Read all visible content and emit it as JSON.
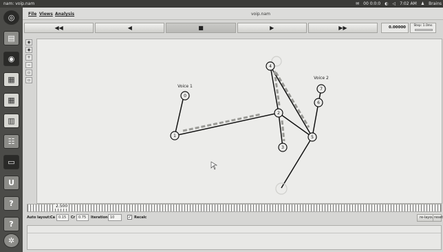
{
  "system_bar": {
    "window_title": "nam: voip.nam",
    "tray_text": "00 0:0:0",
    "time": "7:02 AM",
    "user": "Brains"
  },
  "menu": {
    "items": [
      "File",
      "Views",
      "Analysis"
    ],
    "window_title": "voip.nam"
  },
  "transport": {
    "buttons": [
      "◀◀",
      "◀",
      "■",
      "▶",
      "▶▶"
    ],
    "icons": [
      "rewind-icon",
      "play-back-icon",
      "stop-icon",
      "play-icon",
      "fast-forward-icon"
    ],
    "time_value": "0.00000",
    "step_label": "Step: 1.0ms"
  },
  "topology": {
    "labels": {
      "voice1": "Voice 1",
      "voice2": "Voice 2"
    },
    "nodes": [
      {
        "id": "0"
      },
      {
        "id": "1"
      },
      {
        "id": "2"
      },
      {
        "id": "3"
      },
      {
        "id": "4"
      },
      {
        "id": "5"
      },
      {
        "id": "6"
      },
      {
        "id": "7"
      }
    ]
  },
  "timeline": {
    "label": "2.500"
  },
  "status": {
    "auto_layout": "Auto layout:",
    "ca_label": "Ca",
    "ca_value": "0.15",
    "cr_label": "Cr",
    "cr_value": "0.75",
    "iterations_label": "Iterations",
    "iterations_value": "10",
    "recalc_label": "Recalc",
    "relayout_label": "re-layout",
    "reset_label": "reset"
  }
}
